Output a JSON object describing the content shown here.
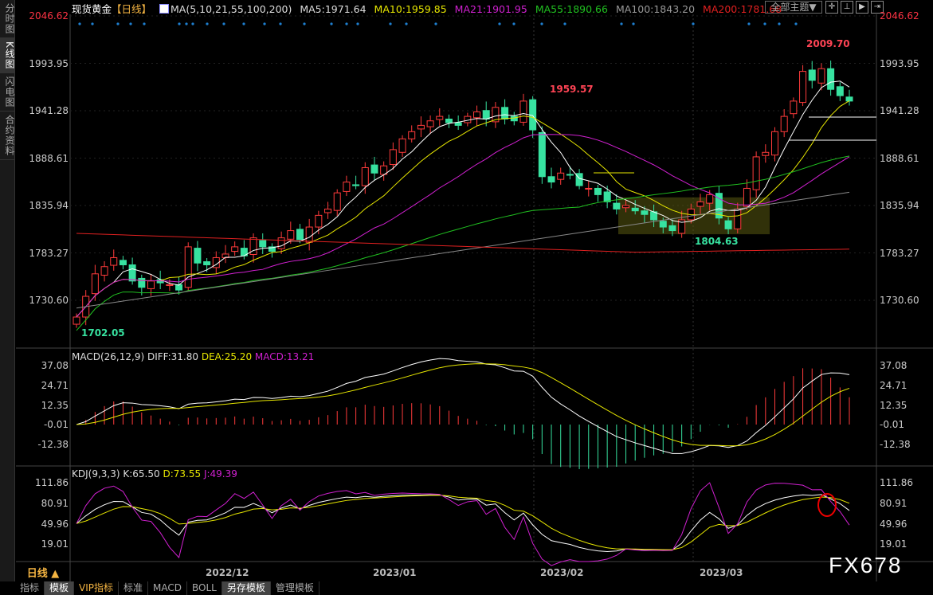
{
  "left_tabs": [
    {
      "label": "分时图"
    },
    {
      "label": "K线图",
      "active": true
    },
    {
      "label": "闪电图"
    },
    {
      "label": "合约资料"
    }
  ],
  "header": {
    "symbol": "现货黄金",
    "period": "【日线】",
    "ma_label": "MA(5,10,21,55,100,200)",
    "ma5": "MA5:1971.64",
    "ma10": "MA10:1959.85",
    "ma21": "MA21:1901.95",
    "ma55": "MA55:1890.66",
    "ma100": "MA100:1843.20",
    "ma200": "MA200:1781.68"
  },
  "toolbar": {
    "theme": "全部主题▼",
    "buttons": [
      "crosshair-icon",
      "zoom-in-icon",
      "play-icon",
      "exit-icon"
    ]
  },
  "colors": {
    "up": "#ff3b3b",
    "down": "#37e2a0",
    "ma5": "#ffffff",
    "ma10": "#e6e600",
    "ma21": "#d020d0",
    "ma55": "#20c020",
    "ma100": "#888888",
    "ma200": "#e02020",
    "axis_red": "#ff3344"
  },
  "price_axis": [
    "2046.62",
    "1993.95",
    "1941.28",
    "1888.61",
    "1835.94",
    "1783.27",
    "1730.60"
  ],
  "price_range": [
    1730.6,
    2046.62
  ],
  "annotations": {
    "high1": "1959.57",
    "low1": "1702.05",
    "low2": "1804.63",
    "high2": "2009.70"
  },
  "macd": {
    "label": "MACD(26,12,9)",
    "diff": "DIFF:31.80",
    "dea": "DEA:25.20",
    "macd": "MACD:13.21",
    "axis": [
      "37.08",
      "24.71",
      "12.35",
      "-0.01",
      "-12.38"
    ]
  },
  "kdj": {
    "label": "KDJ(9,3,3)",
    "k": "K:65.50",
    "d": "D:73.55",
    "j": "J:49.39",
    "axis": [
      "111.86",
      "80.91",
      "49.96",
      "19.01"
    ]
  },
  "period_button": "日线 ▲",
  "dates": [
    "2022/12",
    "2023/01",
    "2023/02",
    "2023/03"
  ],
  "bottom_tabs": [
    {
      "label": "指标"
    },
    {
      "label": "模板",
      "sel": true
    },
    {
      "label": "VIP指标",
      "vip": true
    },
    {
      "label": "标准"
    },
    {
      "label": "MACD"
    },
    {
      "label": "BOLL"
    },
    {
      "label": "另存模板",
      "sel": true
    },
    {
      "label": "管理模板"
    }
  ],
  "watermark": "FX678",
  "chart_data": {
    "type": "candlestick",
    "closes": [
      1712,
      1735,
      1760,
      1768,
      1778,
      1770,
      1752,
      1745,
      1752,
      1750,
      1748,
      1742,
      1790,
      1772,
      1770,
      1778,
      1782,
      1790,
      1780,
      1800,
      1790,
      1785,
      1800,
      1808,
      1798,
      1812,
      1825,
      1832,
      1850,
      1862,
      1858,
      1878,
      1872,
      1880,
      1898,
      1910,
      1918,
      1925,
      1930,
      1935,
      1928,
      1925,
      1935,
      1940,
      1932,
      1945,
      1932,
      1930,
      1952,
      1920,
      1868,
      1862,
      1872,
      1870,
      1858,
      1855,
      1848,
      1840,
      1832,
      1836,
      1830,
      1826,
      1820,
      1812,
      1808,
      1820,
      1832,
      1840,
      1848,
      1822,
      1810,
      1832,
      1855,
      1890,
      1895,
      1918,
      1935,
      1952,
      1985,
      1975,
      1988,
      1965,
      1958,
      1952
    ]
  }
}
